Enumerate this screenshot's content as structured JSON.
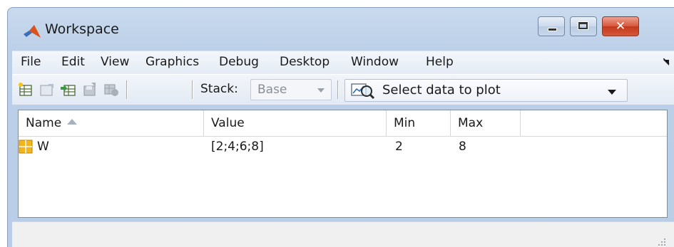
{
  "window": {
    "title": "Workspace",
    "close_glyph": "✕"
  },
  "menu": {
    "items": [
      "File",
      "Edit",
      "View",
      "Graphics",
      "Debug",
      "Desktop",
      "Window",
      "Help"
    ]
  },
  "toolbar": {
    "icons": [
      "new-variable-icon",
      "open-variable-icon",
      "import-data-icon",
      "save-workspace-icon",
      "delete-variable-icon"
    ],
    "stack_label": "Stack:",
    "stack_value": "Base",
    "plot_select_value": "Select data to plot"
  },
  "table": {
    "columns": [
      "Name",
      "Value",
      "Min",
      "Max"
    ],
    "sort_column": "Name",
    "sort_direction": "ascending",
    "rows": [
      {
        "name": "W",
        "value": "[2;4;6;8]",
        "min": "2",
        "max": "8"
      }
    ]
  },
  "colors": {
    "titlebar": "#c9daee",
    "close_button": "#d04a2e",
    "variable_icon": "#f2b61c"
  }
}
